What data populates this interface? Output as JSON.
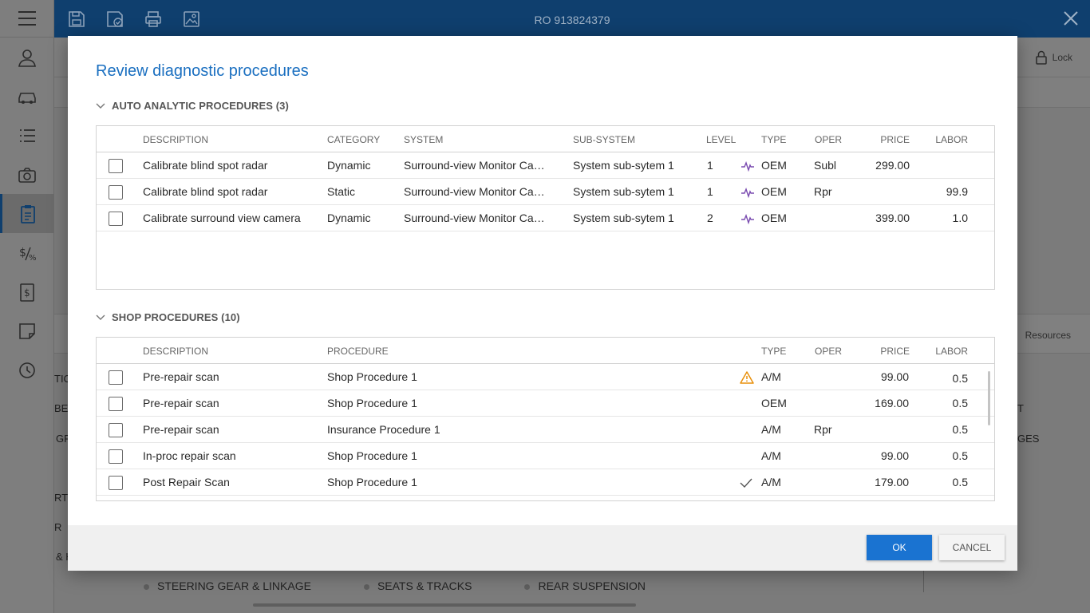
{
  "app": {
    "ro_title": "RO 913824379",
    "lock_label": "Lock",
    "resources_label": "Resources",
    "bg_fragments": [
      "TIC",
      "BEL",
      "GR",
      "RT",
      "R",
      "& H",
      "T",
      "GES"
    ],
    "bottom_links": [
      "STEERING GEAR & LINKAGE",
      "SEATS & TRACKS",
      "REAR SUSPENSION"
    ]
  },
  "modal": {
    "title": "Review diagnostic procedures",
    "auto_section": {
      "title": "AUTO ANALYTIC PROCEDURES (3)",
      "columns": [
        "DESCRIPTION",
        "CATEGORY",
        "SYSTEM",
        "SUB-SYSTEM",
        "LEVEL",
        "TYPE",
        "OPER",
        "PRICE",
        "LABOR"
      ],
      "rows": [
        {
          "description": "Calibrate blind spot radar",
          "category": "Dynamic",
          "system": "Surround-view Monitor Camera",
          "subsystem": "System sub-sytem 1",
          "level": "1",
          "icon": "pulse-icon",
          "type": "OEM",
          "oper": "Subl",
          "price": "299.00",
          "labor": ""
        },
        {
          "description": "Calibrate blind spot radar",
          "category": "Static",
          "system": "Surround-view Monitor Camera",
          "subsystem": "System sub-sytem 1",
          "level": "1",
          "icon": "pulse-icon",
          "type": "OEM",
          "oper": "Rpr",
          "price": "",
          "labor": "99.9"
        },
        {
          "description": "Calibrate surround view camera",
          "category": "Dynamic",
          "system": "Surround-view Monitor Camera",
          "subsystem": "System sub-sytem 1",
          "level": "2",
          "icon": "pulse-icon",
          "type": "OEM",
          "oper": "",
          "price": "399.00",
          "labor": "1.0"
        }
      ]
    },
    "shop_section": {
      "title": "SHOP PROCEDURES (10)",
      "columns": [
        "DESCRIPTION",
        "PROCEDURE",
        "TYPE",
        "OPER",
        "PRICE",
        "LABOR"
      ],
      "rows": [
        {
          "description": "Pre-repair scan",
          "procedure": "Shop Procedure 1",
          "icon": "warning-icon",
          "type": "A/M",
          "oper": "",
          "price": "99.00",
          "labor": "0.5"
        },
        {
          "description": "Pre-repair scan",
          "procedure": "Shop Procedure 1",
          "icon": "",
          "type": "OEM",
          "oper": "",
          "price": "169.00",
          "labor": "0.5"
        },
        {
          "description": "Pre-repair scan",
          "procedure": "Insurance Procedure 1",
          "icon": "",
          "type": "A/M",
          "oper": "Rpr",
          "price": "",
          "labor": "0.5"
        },
        {
          "description": "In-proc repair scan",
          "procedure": "Shop Procedure 1",
          "icon": "",
          "type": "A/M",
          "oper": "",
          "price": "99.00",
          "labor": "0.5"
        },
        {
          "description": "Post Repair Scan",
          "procedure": "Shop Procedure 1",
          "icon": "check-icon",
          "type": "A/M",
          "oper": "",
          "price": "179.00",
          "labor": "0.5"
        }
      ]
    },
    "ok_label": "OK",
    "cancel_label": "CANCEL"
  },
  "colors": {
    "brand_blue": "#0f3f6e",
    "title_blue": "#1a6fc0",
    "ok_blue": "#1a73d1",
    "pulse_purple": "#7a4bb0",
    "warning_orange": "#e8900c"
  }
}
